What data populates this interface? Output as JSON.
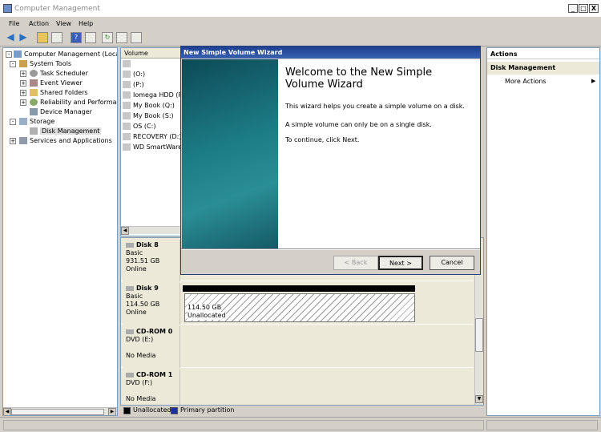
{
  "window": {
    "title": "Computer Management",
    "btn_min": "_",
    "btn_max": "□",
    "btn_close": "X"
  },
  "menu": {
    "file": "File",
    "action": "Action",
    "view": "View",
    "help": "Help"
  },
  "tree": {
    "root": "Computer Management (Local)",
    "system_tools": "System Tools",
    "task_scheduler": "Task Scheduler",
    "event_viewer": "Event Viewer",
    "shared_folders": "Shared Folders",
    "reliability": "Reliability and Performance",
    "device_manager": "Device Manager",
    "storage": "Storage",
    "disk_management": "Disk Management",
    "services": "Services and Applications"
  },
  "volumes": {
    "header": "Volume",
    "rows": [
      "",
      "(O:)",
      "(P:)",
      "Iomega HDD (R:)",
      "My Book (Q:)",
      "My Book (S:)",
      "OS (C:)",
      "RECOVERY (D:)",
      "WD SmartWare (T:)"
    ]
  },
  "disks": [
    {
      "name": "Disk 8",
      "type": "Basic",
      "size": "931.51 GB",
      "status": "Online"
    },
    {
      "name": "Disk 9",
      "type": "Basic",
      "size": "114.50 GB",
      "status": "Online",
      "partition_size": "114.50 GB",
      "partition_state": "Unallocated"
    },
    {
      "name": "CD-ROM 0",
      "type": "DVD (E:)",
      "media": "No Media"
    },
    {
      "name": "CD-ROM 1",
      "type": "DVD (F:)",
      "media": "No Media"
    }
  ],
  "legend": {
    "unallocated": "Unallocated",
    "primary": "Primary partition",
    "color_unallocated": "#000000",
    "color_primary": "#1a2fa0"
  },
  "actions": {
    "header": "Actions",
    "section": "Disk Management",
    "more": "More Actions"
  },
  "wizard": {
    "title": "New Simple Volume Wizard",
    "heading": "Welcome to the New Simple Volume Wizard",
    "p1": "This wizard helps you create a simple volume on a disk.",
    "p2": "A simple volume can only be on a single disk.",
    "p3": "To continue, click Next.",
    "back": "< Back",
    "next": "Next >",
    "cancel": "Cancel"
  }
}
